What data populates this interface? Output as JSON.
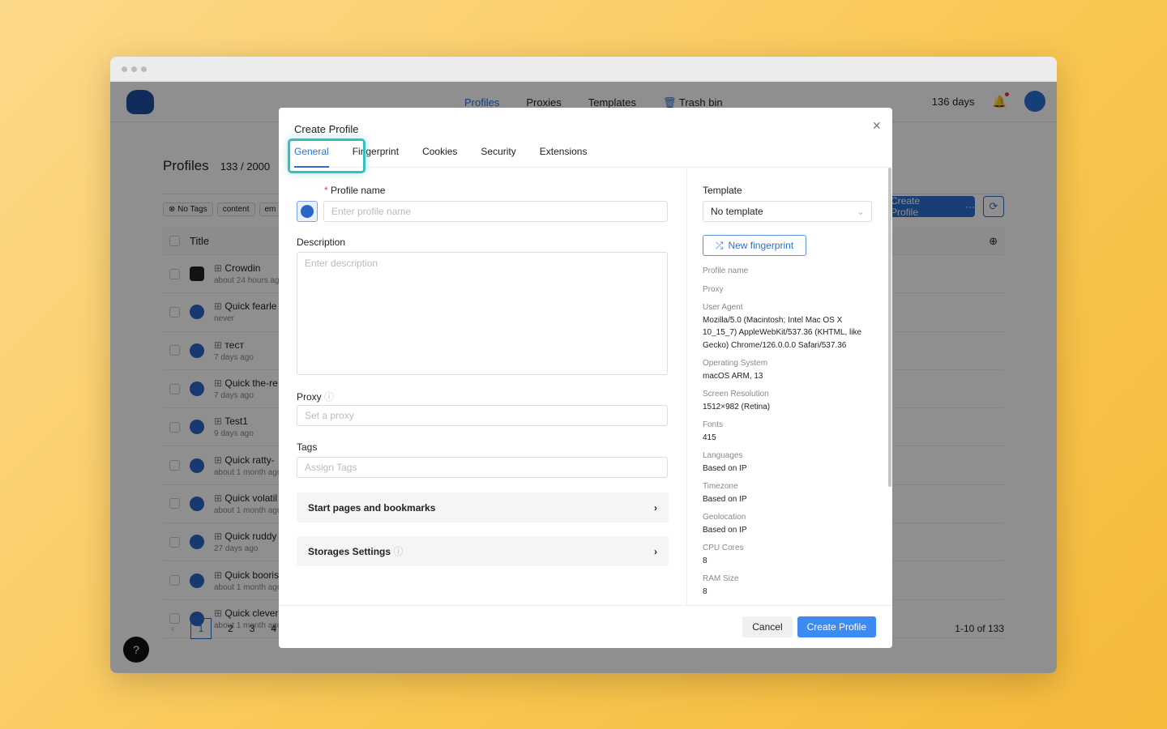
{
  "nav": {
    "items": [
      "Profiles",
      "Proxies",
      "Templates",
      "Trash bin"
    ],
    "days": "136 days"
  },
  "page": {
    "title": "Profiles",
    "count": "133 / 2000",
    "create": "Create Profile",
    "more": "···",
    "tags": [
      "No Tags",
      "content",
      "em"
    ],
    "col_title": "Title",
    "rows": [
      {
        "name": "Crowdin",
        "time": "about 24 hours ago"
      },
      {
        "name": "Quick fearle",
        "time": "never"
      },
      {
        "name": "тест",
        "time": "7 days ago"
      },
      {
        "name": "Quick the-re",
        "time": "7 days ago"
      },
      {
        "name": "Test1",
        "time": "9 days ago"
      },
      {
        "name": "Quick ratty-",
        "time": "about 1 month ago"
      },
      {
        "name": "Quick volatil",
        "time": "about 1 month ago"
      },
      {
        "name": "Quick ruddy",
        "time": "27 days ago"
      },
      {
        "name": "Quick booris",
        "time": "about 1 month ago"
      },
      {
        "name": "Quick clever",
        "time": "about 1 month ago"
      }
    ],
    "pages": [
      "1",
      "2",
      "3",
      "4"
    ],
    "range": "1-10 of 133"
  },
  "modal": {
    "title": "Create Profile",
    "tabs": [
      "General",
      "Fingerprint",
      "Cookies",
      "Security",
      "Extensions"
    ],
    "profile_name_label": "Profile name",
    "profile_name_placeholder": "Enter profile name",
    "description_label": "Description",
    "description_placeholder": "Enter description",
    "proxy_label": "Proxy",
    "proxy_placeholder": "Set a proxy",
    "tags_label": "Tags",
    "tags_placeholder": "Assign Tags",
    "start_pages": "Start pages and bookmarks",
    "storages": "Storages Settings",
    "template_label": "Template",
    "template_value": "No template",
    "new_fingerprint": "New fingerprint",
    "summary": [
      {
        "k": "Profile name",
        "v": ""
      },
      {
        "k": "Proxy",
        "v": ""
      },
      {
        "k": "User Agent",
        "v": "Mozilla/5.0 (Macintosh; Intel Mac OS X 10_15_7) AppleWebKit/537.36 (KHTML, like Gecko) Chrome/126.0.0.0 Safari/537.36"
      },
      {
        "k": "Operating System",
        "v": "macOS ARM, 13"
      },
      {
        "k": "Screen Resolution",
        "v": "1512×982 (Retina)"
      },
      {
        "k": "Fonts",
        "v": "415"
      },
      {
        "k": "Languages",
        "v": "Based on IP"
      },
      {
        "k": "Timezone",
        "v": "Based on IP"
      },
      {
        "k": "Geolocation",
        "v": "Based on IP"
      },
      {
        "k": "CPU Cores",
        "v": "8"
      },
      {
        "k": "RAM Size",
        "v": "8"
      }
    ],
    "cancel": "Cancel",
    "create": "Create Profile"
  },
  "colors": {
    "accent": "#2b6fd6",
    "highlight": "#35c0bf"
  }
}
